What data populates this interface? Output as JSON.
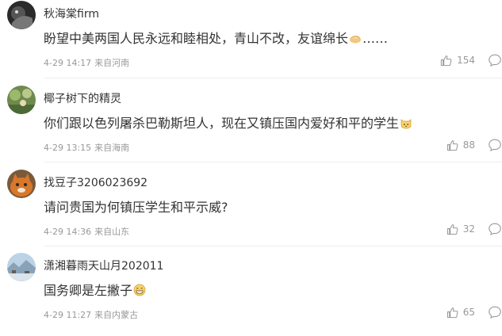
{
  "comments": [
    {
      "username": "秋海棠firm",
      "text": "盼望中美两国人民永远和睦相处，青山不改，友谊绵长",
      "text_suffix": "……",
      "emoji": "dumpling-emoji",
      "time": "4-29 14:17",
      "location": "来自河南",
      "likes": "154",
      "avatar": "dark-bird-avatar"
    },
    {
      "username": "椰子树下的精灵",
      "text": "你们跟以色列屠杀巴勒斯坦人，现在又镇压国内爱好和平的学生",
      "text_suffix": "",
      "emoji": "cat-face-emoji",
      "time": "4-29 13:15",
      "location": "来自海南",
      "likes": "88",
      "avatar": "garden-photo-avatar"
    },
    {
      "username": "找豆子3206023692",
      "text": "请问贵国为何镇压学生和平示威?",
      "text_suffix": "",
      "emoji": "",
      "time": "4-29 14:36",
      "location": "来自山东",
      "likes": "32",
      "avatar": "orange-cat-avatar"
    },
    {
      "username": "潇湘暮雨天山月202011",
      "text": "国务卿是左撇子",
      "text_suffix": "",
      "emoji": "grin-emoji",
      "time": "4-29 11:27",
      "location": "来自内蒙古",
      "likes": "65",
      "avatar": "landscape-avatar"
    }
  ],
  "colors": {
    "text": "#333333",
    "meta": "#999999",
    "divider": "#efefef"
  },
  "icons": {
    "like": "thumbs-up-icon",
    "reply": "comment-bubble-icon"
  }
}
